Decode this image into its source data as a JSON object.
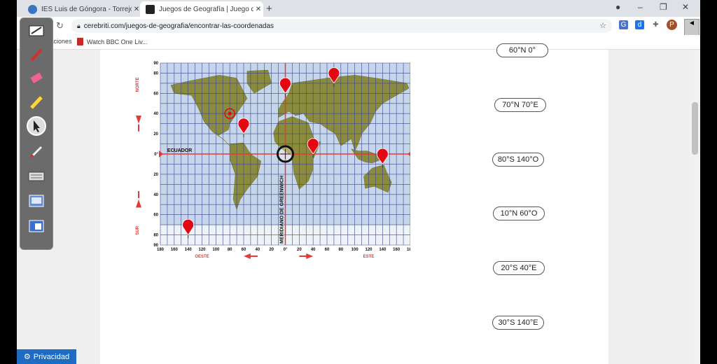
{
  "browser": {
    "tabs": [
      {
        "title": "IES Luis de Góngora - Torrejón de",
        "active": false
      },
      {
        "title": "Juegos de Geografía | Juego de",
        "active": true
      }
    ],
    "new_tab": "+",
    "url": "cerebriti.com/juegos-de-geografia/encontrar-las-coordenadas",
    "bookmarks": [
      {
        "label": "Aplicaciones"
      },
      {
        "label": "Watch BBC One Liv..."
      }
    ],
    "profile_initial": "P"
  },
  "map": {
    "label_norte": "NORTE",
    "label_sur": "SUR",
    "label_ecuador": "ECUADOR",
    "label_meridiano": "MERIDIANO DE GREENWICH",
    "label_oeste": "OESTE",
    "label_este": "ESTE",
    "lat_ticks": [
      "90",
      "80",
      "60",
      "40",
      "20",
      "0°",
      "20",
      "40",
      "60",
      "80",
      "90"
    ],
    "lon_ticks": [
      "180",
      "160",
      "140",
      "120",
      "100",
      "80",
      "60",
      "40",
      "20",
      "0°",
      "20",
      "40",
      "60",
      "80",
      "100",
      "120",
      "140",
      "160",
      "180"
    ],
    "markers": [
      {
        "type": "pin",
        "lat": 70,
        "lon": 70
      },
      {
        "type": "pin",
        "lat": 60,
        "lon": 0
      },
      {
        "type": "pin",
        "lat": 20,
        "lon": -60
      },
      {
        "type": "pin",
        "lat": 0,
        "lon": 40
      },
      {
        "type": "pin",
        "lat": -10,
        "lon": 140
      },
      {
        "type": "pin",
        "lat": -80,
        "lon": -140
      },
      {
        "type": "ring",
        "lat": 40,
        "lon": -80
      },
      {
        "type": "cursor",
        "lat": 0,
        "lon": 0
      }
    ]
  },
  "answers": [
    "60°N 0°",
    "70°N 70°E",
    "80°S 140°O",
    "10°N 60°O",
    "20°S 40°E",
    "30°S 140°E"
  ],
  "privacy_label": "Privacidad",
  "colors": {
    "ocean": "#c5d6ea",
    "land": "#8a8b3c",
    "grid": "#3f4590",
    "axis": "#e53935",
    "pin": "#e30613"
  }
}
